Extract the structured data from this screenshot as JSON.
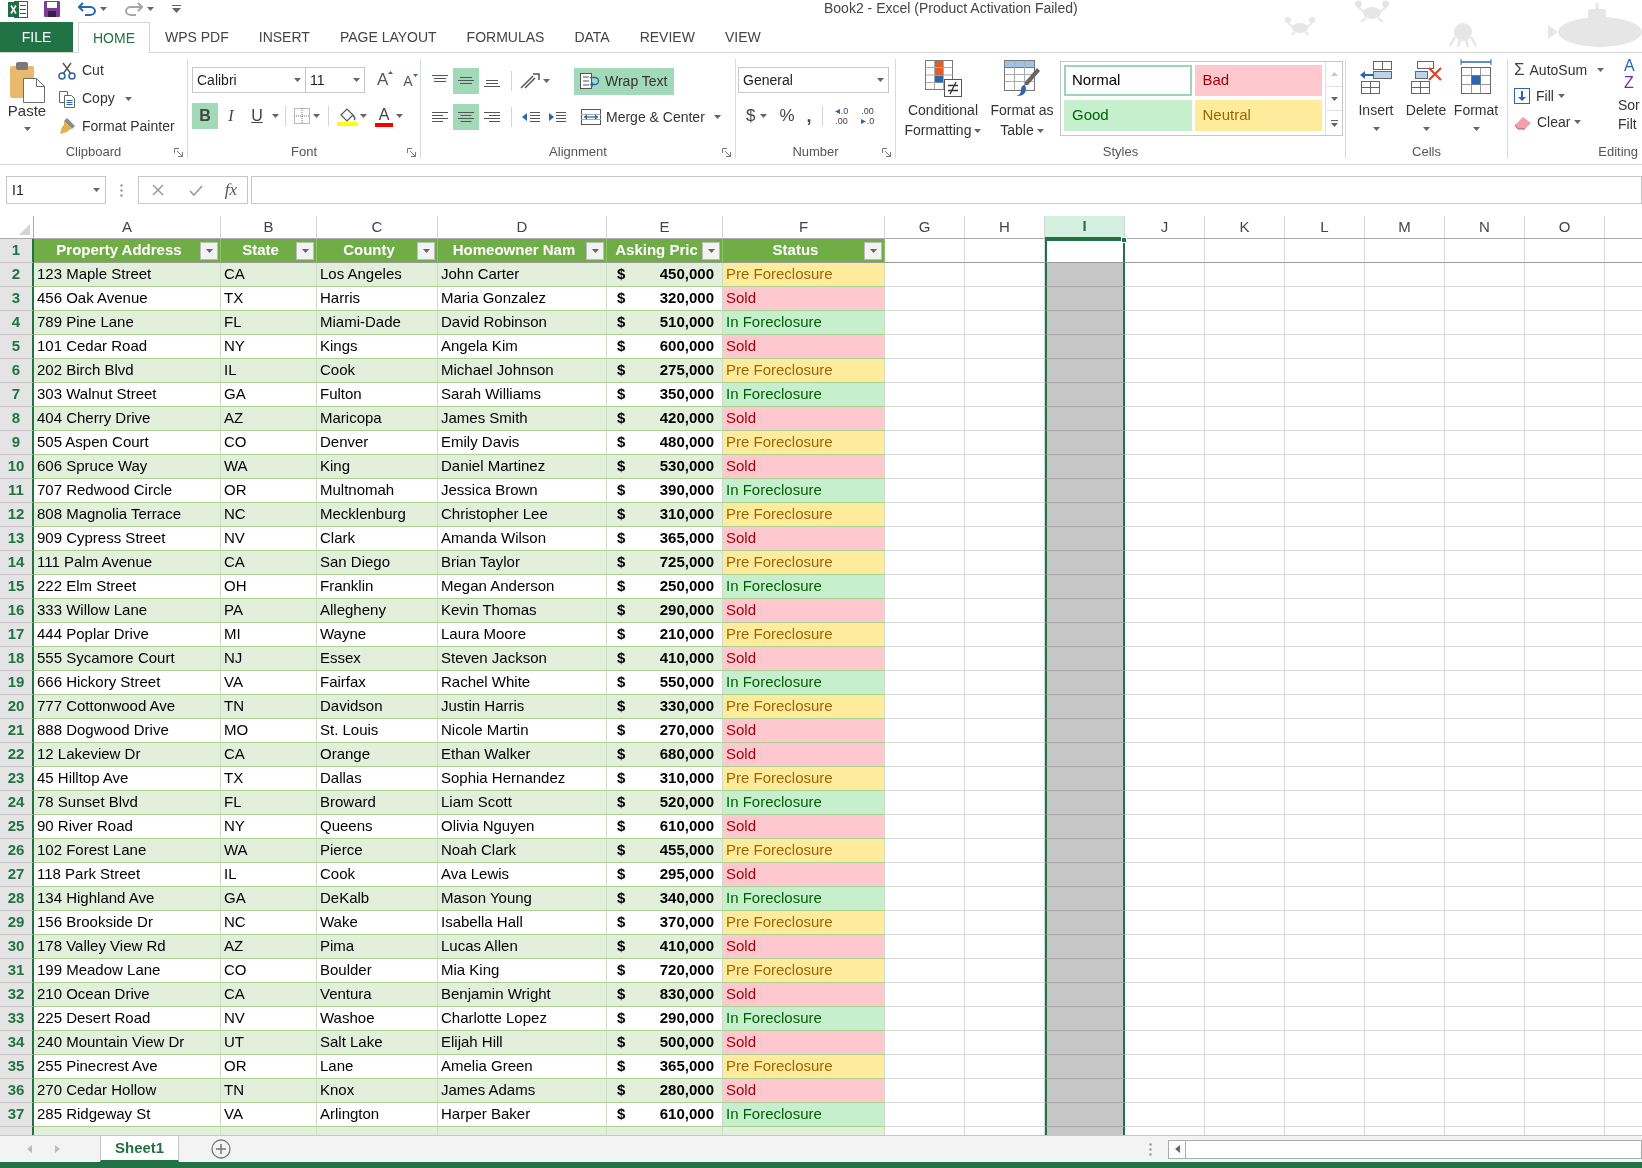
{
  "window": {
    "title": "Book2 - Excel (Product Activation Failed)"
  },
  "ribbon_tabs": [
    {
      "label": "FILE",
      "kind": "file",
      "selected": false
    },
    {
      "label": "HOME",
      "kind": "tab",
      "selected": true
    },
    {
      "label": "WPS PDF",
      "kind": "tab",
      "selected": false
    },
    {
      "label": "INSERT",
      "kind": "tab",
      "selected": false
    },
    {
      "label": "PAGE LAYOUT",
      "kind": "tab",
      "selected": false
    },
    {
      "label": "FORMULAS",
      "kind": "tab",
      "selected": false
    },
    {
      "label": "DATA",
      "kind": "tab",
      "selected": false
    },
    {
      "label": "REVIEW",
      "kind": "tab",
      "selected": false
    },
    {
      "label": "VIEW",
      "kind": "tab",
      "selected": false
    }
  ],
  "clipboard": {
    "paste": "Paste",
    "cut": "Cut",
    "copy": "Copy",
    "format_painter": "Format Painter",
    "label": "Clipboard"
  },
  "font": {
    "name": "Calibri",
    "size": "11",
    "grow": "A",
    "shrink": "A",
    "styles": [
      {
        "glyph": "B",
        "kind": "bold",
        "on": true
      },
      {
        "glyph": "I",
        "kind": "italic",
        "on": false
      },
      {
        "glyph": "U",
        "kind": "underline",
        "on": false
      }
    ],
    "font_color_glyph": "A",
    "label": "Font"
  },
  "alignment": {
    "vertical": [
      {
        "kind": "top",
        "selected": false
      },
      {
        "kind": "middle",
        "selected": true
      },
      {
        "kind": "bottom",
        "selected": false
      }
    ],
    "horizontal": [
      {
        "kind": "left",
        "selected": false
      },
      {
        "kind": "center",
        "selected": true
      },
      {
        "kind": "right",
        "selected": false
      }
    ],
    "wrap_text": {
      "label": "Wrap Text",
      "on": true
    },
    "merge": {
      "label": "Merge & Center",
      "on": false
    },
    "label": "Alignment"
  },
  "number": {
    "format": "General",
    "currency": "$",
    "percent": "%",
    "comma": ",",
    "decimals": [
      {
        "kind": "increase",
        "upper": ".0",
        "lower": ".00"
      },
      {
        "kind": "decrease",
        "upper": ".00",
        "lower": ".0"
      }
    ],
    "label": "Number"
  },
  "styles": {
    "conditional_formatting": "Conditional Formatting",
    "format_as_table": "Format as Table",
    "gallery": [
      {
        "label": "Normal",
        "kind": "normal",
        "selected": true
      },
      {
        "label": "Bad",
        "kind": "bad",
        "selected": false
      },
      {
        "label": "Good",
        "kind": "good",
        "selected": false
      },
      {
        "label": "Neutral",
        "kind": "neutral",
        "selected": false
      }
    ],
    "label": "Styles"
  },
  "cells": {
    "buttons": [
      {
        "label": "Insert",
        "kind": "insert"
      },
      {
        "label": "Delete",
        "kind": "delete"
      },
      {
        "label": "Format",
        "kind": "format"
      }
    ],
    "label": "Cells"
  },
  "editing": {
    "autosum_glyph": "Σ",
    "autosum": "AutoSum",
    "fill": "Fill",
    "clear": "Clear",
    "sort_glyphs": [
      "A",
      "Z"
    ],
    "sort_lines": [
      "Sor",
      "Filt"
    ],
    "label": "Editing"
  },
  "formula_bar": {
    "name_box": "I1",
    "fx": "fx"
  },
  "sheet": {
    "columns": [
      {
        "letter": "A",
        "selected": false
      },
      {
        "letter": "B",
        "selected": false
      },
      {
        "letter": "C",
        "selected": false
      },
      {
        "letter": "D",
        "selected": false
      },
      {
        "letter": "E",
        "selected": false
      },
      {
        "letter": "F",
        "selected": false
      },
      {
        "letter": "G",
        "selected": false
      },
      {
        "letter": "H",
        "selected": false
      },
      {
        "letter": "I",
        "selected": true
      },
      {
        "letter": "J",
        "selected": false
      },
      {
        "letter": "K",
        "selected": false
      },
      {
        "letter": "L",
        "selected": false
      },
      {
        "letter": "M",
        "selected": false
      },
      {
        "letter": "N",
        "selected": false
      },
      {
        "letter": "O",
        "selected": false
      }
    ],
    "header_row": {
      "number": "1",
      "cells": [
        "Property Address",
        "State",
        "County",
        "Homeowner Nam",
        "Asking Pric",
        "Status"
      ]
    },
    "rows": [
      {
        "number": "2",
        "cells": [
          "123 Maple Street",
          "CA",
          "Los Angeles",
          "John Carter"
        ],
        "currency": "$",
        "price": "450,000",
        "status": "Pre Foreclosure",
        "kind": "neutral"
      },
      {
        "number": "3",
        "cells": [
          "456 Oak Avenue",
          "TX",
          "Harris",
          "Maria Gonzalez"
        ],
        "currency": "$",
        "price": "320,000",
        "status": "Sold",
        "kind": "bad"
      },
      {
        "number": "4",
        "cells": [
          "789 Pine Lane",
          "FL",
          "Miami-Dade",
          "David Robinson"
        ],
        "currency": "$",
        "price": "510,000",
        "status": "In Foreclosure",
        "kind": "good"
      },
      {
        "number": "5",
        "cells": [
          "101 Cedar Road",
          "NY",
          "Kings",
          "Angela Kim"
        ],
        "currency": "$",
        "price": "600,000",
        "status": "Sold",
        "kind": "bad"
      },
      {
        "number": "6",
        "cells": [
          "202 Birch Blvd",
          "IL",
          "Cook",
          "Michael Johnson"
        ],
        "currency": "$",
        "price": "275,000",
        "status": "Pre Foreclosure",
        "kind": "neutral"
      },
      {
        "number": "7",
        "cells": [
          "303 Walnut Street",
          "GA",
          "Fulton",
          "Sarah Williams"
        ],
        "currency": "$",
        "price": "350,000",
        "status": "In Foreclosure",
        "kind": "good"
      },
      {
        "number": "8",
        "cells": [
          "404 Cherry Drive",
          "AZ",
          "Maricopa",
          "James Smith"
        ],
        "currency": "$",
        "price": "420,000",
        "status": "Sold",
        "kind": "bad"
      },
      {
        "number": "9",
        "cells": [
          "505 Aspen Court",
          "CO",
          "Denver",
          "Emily Davis"
        ],
        "currency": "$",
        "price": "480,000",
        "status": "Pre Foreclosure",
        "kind": "neutral"
      },
      {
        "number": "10",
        "cells": [
          "606 Spruce Way",
          "WA",
          "King",
          "Daniel Martinez"
        ],
        "currency": "$",
        "price": "530,000",
        "status": "Sold",
        "kind": "bad"
      },
      {
        "number": "11",
        "cells": [
          "707 Redwood Circle",
          "OR",
          "Multnomah",
          "Jessica Brown"
        ],
        "currency": "$",
        "price": "390,000",
        "status": "In Foreclosure",
        "kind": "good"
      },
      {
        "number": "12",
        "cells": [
          "808 Magnolia Terrace",
          "NC",
          "Mecklenburg",
          "Christopher Lee"
        ],
        "currency": "$",
        "price": "310,000",
        "status": "Pre Foreclosure",
        "kind": "neutral"
      },
      {
        "number": "13",
        "cells": [
          "909 Cypress Street",
          "NV",
          "Clark",
          "Amanda Wilson"
        ],
        "currency": "$",
        "price": "365,000",
        "status": "Sold",
        "kind": "bad"
      },
      {
        "number": "14",
        "cells": [
          "111 Palm Avenue",
          "CA",
          "San Diego",
          "Brian Taylor"
        ],
        "currency": "$",
        "price": "725,000",
        "status": "Pre Foreclosure",
        "kind": "neutral"
      },
      {
        "number": "15",
        "cells": [
          "222 Elm Street",
          "OH",
          "Franklin",
          "Megan Anderson"
        ],
        "currency": "$",
        "price": "250,000",
        "status": "In Foreclosure",
        "kind": "good"
      },
      {
        "number": "16",
        "cells": [
          "333 Willow Lane",
          "PA",
          "Allegheny",
          "Kevin Thomas"
        ],
        "currency": "$",
        "price": "290,000",
        "status": "Sold",
        "kind": "bad"
      },
      {
        "number": "17",
        "cells": [
          "444 Poplar Drive",
          "MI",
          "Wayne",
          "Laura Moore"
        ],
        "currency": "$",
        "price": "210,000",
        "status": "Pre Foreclosure",
        "kind": "neutral"
      },
      {
        "number": "18",
        "cells": [
          "555 Sycamore Court",
          "NJ",
          "Essex",
          "Steven Jackson"
        ],
        "currency": "$",
        "price": "410,000",
        "status": "Sold",
        "kind": "bad"
      },
      {
        "number": "19",
        "cells": [
          "666 Hickory Street",
          "VA",
          "Fairfax",
          "Rachel White"
        ],
        "currency": "$",
        "price": "550,000",
        "status": "In Foreclosure",
        "kind": "good"
      },
      {
        "number": "20",
        "cells": [
          "777 Cottonwood Ave",
          "TN",
          "Davidson",
          "Justin Harris"
        ],
        "currency": "$",
        "price": "330,000",
        "status": "Pre Foreclosure",
        "kind": "neutral"
      },
      {
        "number": "21",
        "cells": [
          "888 Dogwood Drive",
          "MO",
          "St. Louis",
          "Nicole Martin"
        ],
        "currency": "$",
        "price": "270,000",
        "status": "Sold",
        "kind": "bad"
      },
      {
        "number": "22",
        "cells": [
          "12 Lakeview Dr",
          "CA",
          "Orange",
          "Ethan Walker"
        ],
        "currency": "$",
        "price": "680,000",
        "status": "Sold",
        "kind": "bad"
      },
      {
        "number": "23",
        "cells": [
          "45 Hilltop Ave",
          "TX",
          "Dallas",
          "Sophia Hernandez"
        ],
        "currency": "$",
        "price": "310,000",
        "status": "Pre Foreclosure",
        "kind": "neutral"
      },
      {
        "number": "24",
        "cells": [
          "78 Sunset Blvd",
          "FL",
          "Broward",
          "Liam Scott"
        ],
        "currency": "$",
        "price": "520,000",
        "status": "In Foreclosure",
        "kind": "good"
      },
      {
        "number": "25",
        "cells": [
          "90 River Road",
          "NY",
          "Queens",
          "Olivia Nguyen"
        ],
        "currency": "$",
        "price": "610,000",
        "status": "Sold",
        "kind": "bad"
      },
      {
        "number": "26",
        "cells": [
          "102 Forest Lane",
          "WA",
          "Pierce",
          "Noah Clark"
        ],
        "currency": "$",
        "price": "455,000",
        "status": "Pre Foreclosure",
        "kind": "neutral"
      },
      {
        "number": "27",
        "cells": [
          "118 Park Street",
          "IL",
          "Cook",
          "Ava Lewis"
        ],
        "currency": "$",
        "price": "295,000",
        "status": "Sold",
        "kind": "bad"
      },
      {
        "number": "28",
        "cells": [
          "134 Highland Ave",
          "GA",
          "DeKalb",
          "Mason Young"
        ],
        "currency": "$",
        "price": "340,000",
        "status": "In Foreclosure",
        "kind": "good"
      },
      {
        "number": "29",
        "cells": [
          "156 Brookside Dr",
          "NC",
          "Wake",
          "Isabella Hall"
        ],
        "currency": "$",
        "price": "370,000",
        "status": "Pre Foreclosure",
        "kind": "neutral"
      },
      {
        "number": "30",
        "cells": [
          "178 Valley View Rd",
          "AZ",
          "Pima",
          "Lucas Allen"
        ],
        "currency": "$",
        "price": "410,000",
        "status": "Sold",
        "kind": "bad"
      },
      {
        "number": "31",
        "cells": [
          "199 Meadow Lane",
          "CO",
          "Boulder",
          "Mia King"
        ],
        "currency": "$",
        "price": "720,000",
        "status": "Pre Foreclosure",
        "kind": "neutral"
      },
      {
        "number": "32",
        "cells": [
          "210 Ocean Drive",
          "CA",
          "Ventura",
          "Benjamin Wright"
        ],
        "currency": "$",
        "price": "830,000",
        "status": "Sold",
        "kind": "bad"
      },
      {
        "number": "33",
        "cells": [
          "225 Desert Road",
          "NV",
          "Washoe",
          "Charlotte Lopez"
        ],
        "currency": "$",
        "price": "290,000",
        "status": "In Foreclosure",
        "kind": "good"
      },
      {
        "number": "34",
        "cells": [
          "240 Mountain View Dr",
          "UT",
          "Salt Lake",
          "Elijah Hill"
        ],
        "currency": "$",
        "price": "500,000",
        "status": "Sold",
        "kind": "bad"
      },
      {
        "number": "35",
        "cells": [
          "255 Pinecrest Ave",
          "OR",
          "Lane",
          "Amelia Green"
        ],
        "currency": "$",
        "price": "365,000",
        "status": "Pre Foreclosure",
        "kind": "neutral"
      },
      {
        "number": "36",
        "cells": [
          "270 Cedar Hollow",
          "TN",
          "Knox",
          "James Adams"
        ],
        "currency": "$",
        "price": "280,000",
        "status": "Sold",
        "kind": "bad"
      },
      {
        "number": "37",
        "cells": [
          "285 Ridgeway St",
          "VA",
          "Arlington",
          "Harper Baker"
        ],
        "currency": "$",
        "price": "610,000",
        "status": "In Foreclosure",
        "kind": "good"
      }
    ]
  },
  "sheet_tabs": [
    {
      "label": "Sheet1",
      "selected": true
    }
  ]
}
